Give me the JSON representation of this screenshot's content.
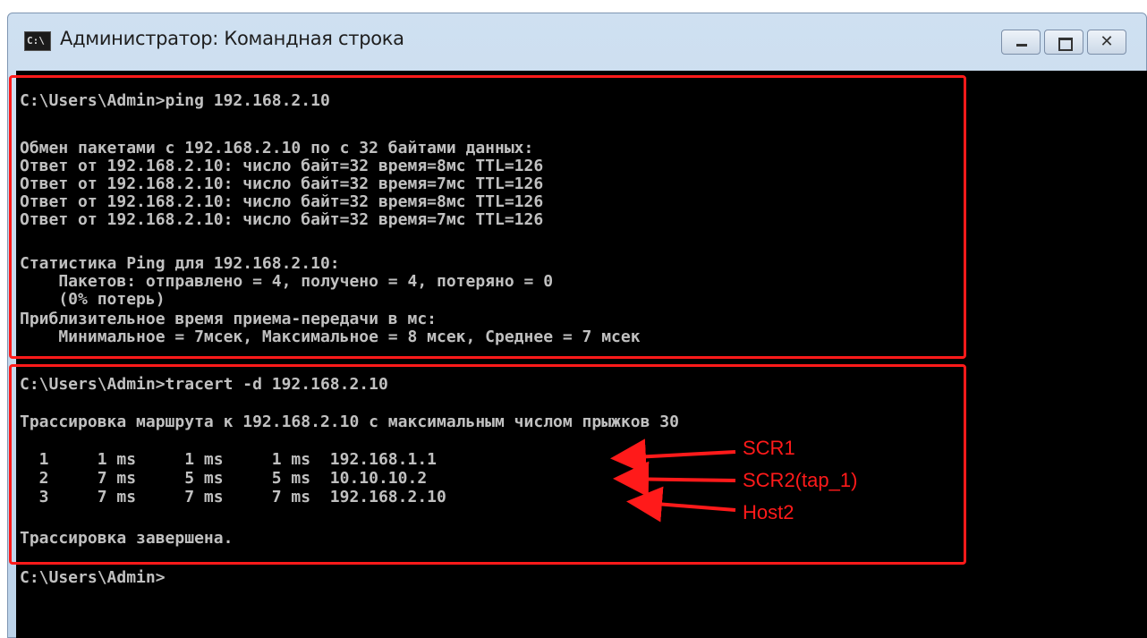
{
  "window": {
    "title": "Администратор: Командная строка",
    "icon_text": "C:\\",
    "controls": {
      "minimize": "minimize-icon",
      "maximize": "maximize-icon",
      "close_glyph": "✕"
    }
  },
  "console": {
    "lines": [
      "C:\\Users\\Admin>ping 192.168.2.10",
      "",
      "Обмен пакетами с 192.168.2.10 по с 32 байтами данных:",
      "Ответ от 192.168.2.10: число байт=32 время=8мс TTL=126",
      "Ответ от 192.168.2.10: число байт=32 время=7мс TTL=126",
      "Ответ от 192.168.2.10: число байт=32 время=8мс TTL=126",
      "Ответ от 192.168.2.10: число байт=32 время=7мс TTL=126",
      "",
      "Статистика Ping для 192.168.2.10:",
      "    Пакетов: отправлено = 4, получено = 4, потеряно = 0",
      "    (0% потерь)",
      "Приблизительное время приема-передачи в мс:",
      "    Минимальное = 7мсек, Максимальное = 8 мсек, Среднее = 7 мсек",
      "C:\\Users\\Admin>tracert -d 192.168.2.10",
      "",
      "Трассировка маршрута к 192.168.2.10 с максимальным числом прыжков 30",
      "",
      "  1     1 ms     1 ms     1 ms  192.168.1.1",
      "  2     7 ms     5 ms     5 ms  10.10.10.2",
      "  3     7 ms     7 ms     7 ms  192.168.2.10",
      "",
      "Трассировка завершена.",
      "",
      "C:\\Users\\Admin>"
    ]
  },
  "annotations": {
    "color": "#ff1a1a",
    "labels": [
      "SCR1",
      "SCR2(tap_1)",
      "Host2"
    ]
  }
}
